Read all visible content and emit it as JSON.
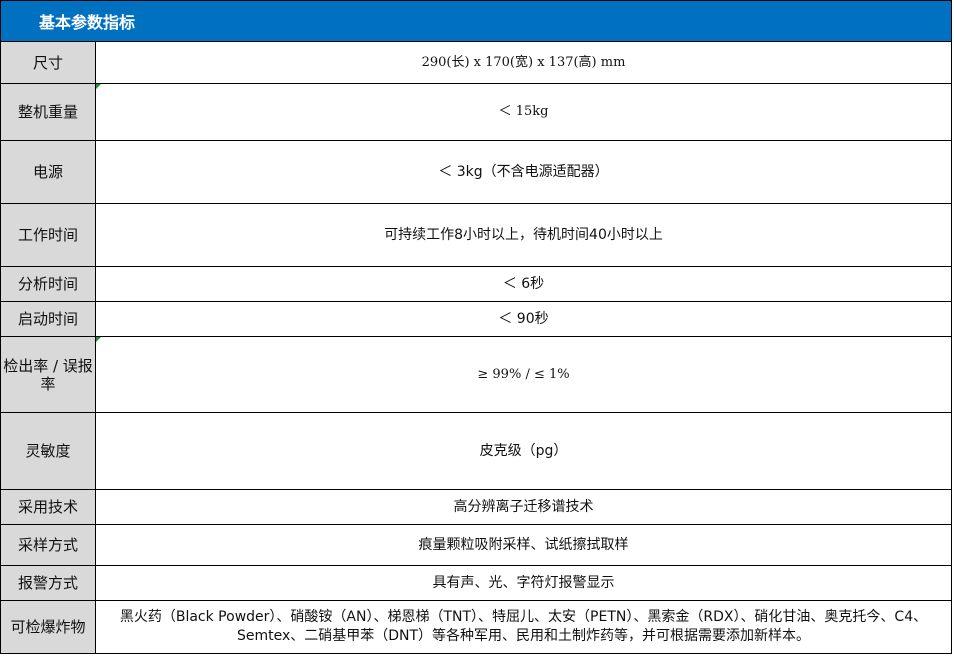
{
  "header": {
    "title": "基本参数指标"
  },
  "rows": [
    {
      "label": "尺寸",
      "value": "290(长) x 170(宽) x 137(高) mm"
    },
    {
      "label": "整机重量",
      "value": "＜ 15kg"
    },
    {
      "label": "电源",
      "value": "＜ 3kg（不含电源适配器）"
    },
    {
      "label": "工作时间",
      "value": "可持续工作8小时以上，待机时间40小时以上"
    },
    {
      "label": "分析时间",
      "value": "＜ 6秒"
    },
    {
      "label": "启动时间",
      "value": "＜ 90秒"
    },
    {
      "label": "检出率 / 误报率",
      "value": "≥ 99% / ≤ 1%"
    },
    {
      "label": "灵敏度",
      "value": "皮克级（pg）"
    },
    {
      "label": "采用技术",
      "value": "高分辨离子迁移谱技术"
    },
    {
      "label": "采样方式",
      "value": "痕量颗粒吸附采样、试纸擦拭取样"
    },
    {
      "label": "报警方式",
      "value": "具有声、光、字符灯报警显示"
    },
    {
      "label": "可检爆炸物",
      "value": "黑火药（Black Powder）、硝酸铵（AN）、梯恩梯（TNT）、特屈儿、太安（PETN）、黑索金（RDX）、硝化甘油、奥克托今、C4、Semtex、二硝基甲苯（DNT）等各种军用、民用和土制炸药等，并可根据需要添加新样本。"
    }
  ],
  "colors": {
    "header_bg": "#0070c0",
    "label_bg": "#d9d9d9",
    "marker": "#1f8f3a"
  }
}
